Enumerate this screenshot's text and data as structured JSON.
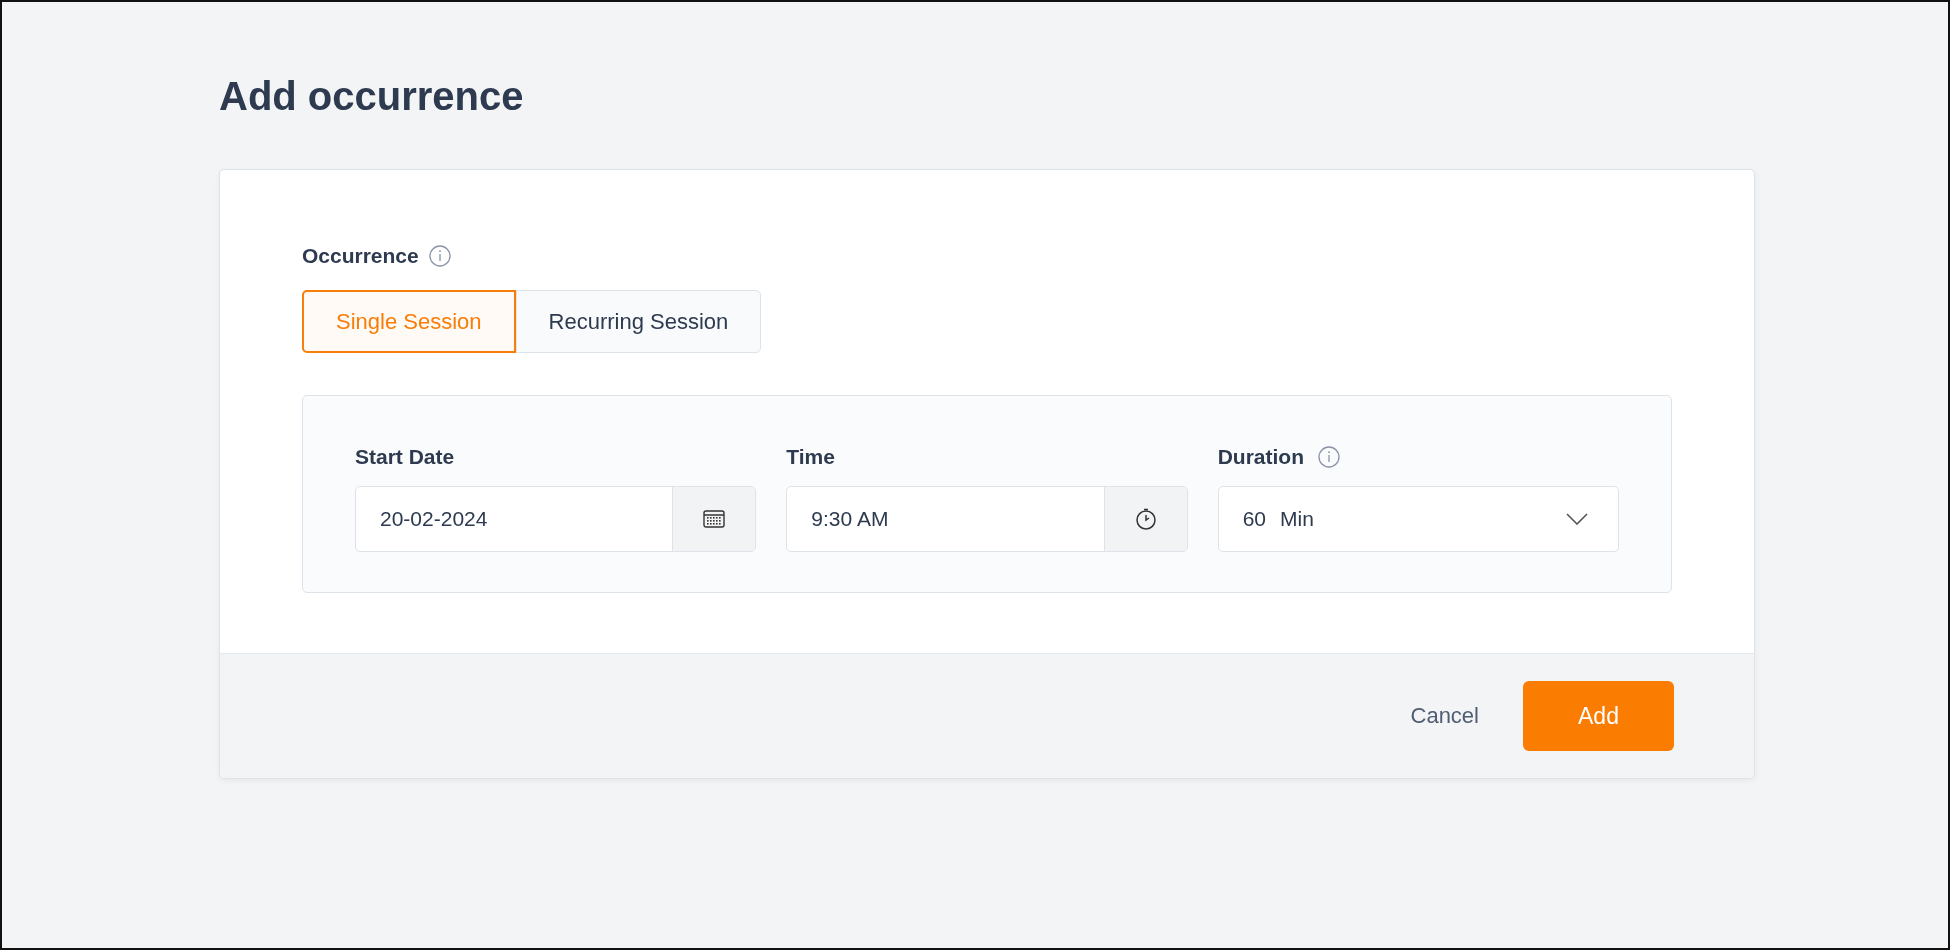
{
  "page": {
    "title": "Add occurrence"
  },
  "occurrence": {
    "label": "Occurrence",
    "options": [
      {
        "label": "Single Session",
        "selected": true
      },
      {
        "label": "Recurring Session",
        "selected": false
      }
    ]
  },
  "fields": [
    {
      "kind": "date",
      "label": "Start Date",
      "value": "20-02-2024",
      "info": false
    },
    {
      "kind": "time",
      "label": "Time",
      "value": "9:30 AM",
      "info": false
    },
    {
      "kind": "select",
      "label": "Duration",
      "value": "60",
      "unit": "Min",
      "info": true
    }
  ],
  "footer": {
    "cancel": "Cancel",
    "submit": "Add"
  }
}
